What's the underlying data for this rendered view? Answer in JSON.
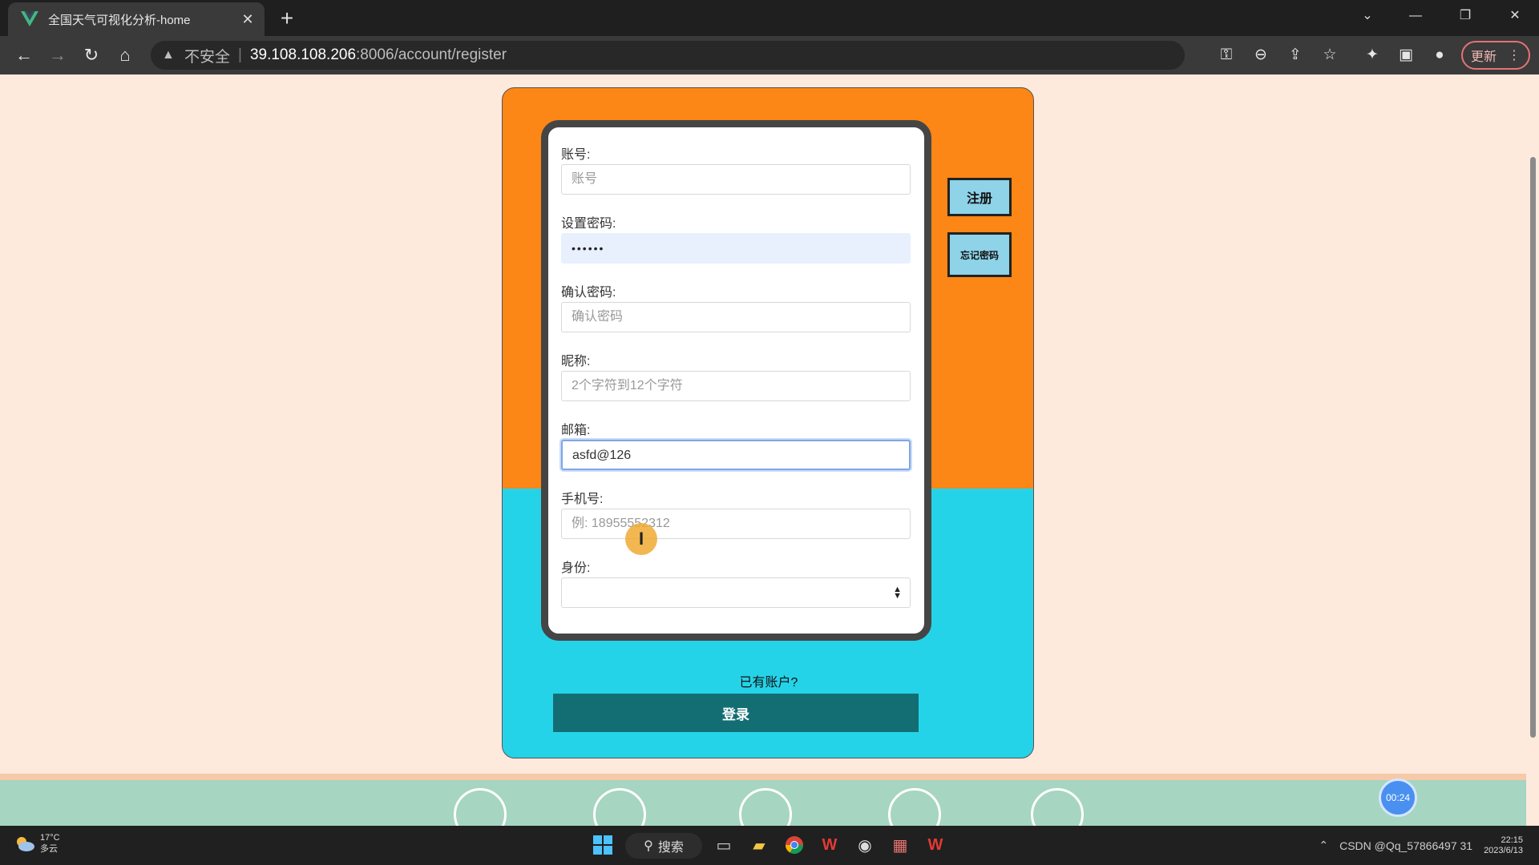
{
  "browser": {
    "tab_title": "全国天气可视化分析-home",
    "tab_close": "✕",
    "new_tab": "+",
    "omnibox": {
      "insecure_label": "不安全",
      "separator": "|",
      "host": "39.108.108.206",
      "path": ":8006/account/register"
    },
    "update_label": "更新"
  },
  "form": {
    "account": {
      "label": "账号:",
      "placeholder": "账号",
      "value": ""
    },
    "password": {
      "label": "设置密码:",
      "value": "••••••"
    },
    "confirm_password": {
      "label": "确认密码:",
      "placeholder": "确认密码",
      "value": ""
    },
    "nickname": {
      "label": "昵称:",
      "placeholder": "2个字符到12个字符",
      "value": ""
    },
    "email": {
      "label": "邮箱:",
      "value": "asfd@126"
    },
    "phone": {
      "label": "手机号:",
      "placeholder": "例: 18955552312",
      "value": ""
    },
    "identity": {
      "label": "身份:",
      "value": ""
    }
  },
  "side_buttons": {
    "register": "注册",
    "forgot_password": "忘记密码"
  },
  "login": {
    "have_account": "已有账户?",
    "button": "登录"
  },
  "recorder": {
    "timer": "00:24"
  },
  "taskbar": {
    "weather_temp": "17°C",
    "weather_desc": "多云",
    "search_label": "搜索",
    "tray_text": "CSDN @Qq_57866497 31",
    "time": "22:15",
    "date": "2023/6/13"
  },
  "colors": {
    "panel_top": "#fc8616",
    "panel_bottom": "#25d3e8",
    "login_button": "#136e73",
    "side_button": "#8ed3e8",
    "page_background": "#fdeadc"
  }
}
